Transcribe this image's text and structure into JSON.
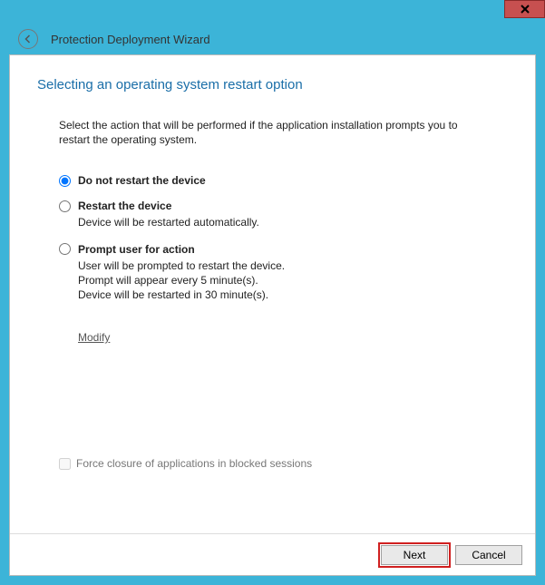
{
  "window": {
    "title": "Protection Deployment Wizard"
  },
  "page": {
    "title": "Selecting an operating system restart option",
    "instruction": "Select the action that will be performed if the application installation prompts you to restart the operating system."
  },
  "options": {
    "do_not_restart": {
      "label": "Do not restart the device",
      "selected": true
    },
    "restart": {
      "label": "Restart the device",
      "desc": "Device will be restarted automatically.",
      "selected": false
    },
    "prompt": {
      "label": "Prompt user for action",
      "desc_line1": "User will be prompted to restart the device.",
      "desc_line2": "Prompt will appear every 5 minute(s).",
      "desc_line3": "Device will be restarted in 30 minute(s).",
      "selected": false
    }
  },
  "modify_link": "Modify",
  "force_closure": {
    "label": "Force closure of applications in blocked sessions",
    "checked": false
  },
  "footer": {
    "next": "Next",
    "cancel": "Cancel"
  }
}
